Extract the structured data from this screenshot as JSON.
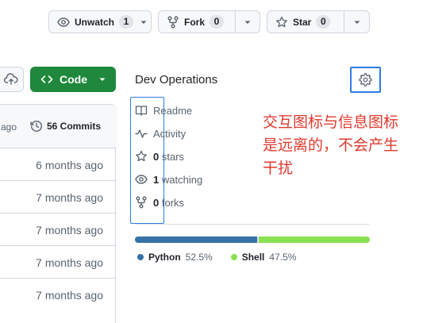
{
  "repo_actions": {
    "watch": {
      "label": "Unwatch",
      "count": "1",
      "icon": "eye-icon"
    },
    "fork": {
      "label": "Fork",
      "count": "0",
      "icon": "repo-forked-icon"
    },
    "star": {
      "label": "Star",
      "count": "0",
      "icon": "star-icon"
    }
  },
  "code_button": {
    "label": "Code"
  },
  "commits": {
    "ago_fragment": "ago",
    "count_label": "56 Commits",
    "rows": [
      "6 months ago",
      "7 months ago",
      "7 months ago",
      "7 months ago",
      "7 months ago"
    ]
  },
  "about": {
    "description": "Dev Operations",
    "links": [
      {
        "icon": "book-icon",
        "bold": "",
        "text": "Readme"
      },
      {
        "icon": "pulse-icon",
        "bold": "",
        "text": "Activity"
      },
      {
        "icon": "star-icon",
        "bold": "0",
        "text": "stars"
      },
      {
        "icon": "eye-icon",
        "bold": "1",
        "text": "watching"
      },
      {
        "icon": "repo-forked-icon",
        "bold": "0",
        "text": "forks"
      }
    ]
  },
  "annotation": {
    "text": "交互图标与信息图标是远离的，不会产生干扰"
  },
  "languages": [
    {
      "name": "Python",
      "percent": "52.5%",
      "value": 52.5,
      "color": "#3572A5"
    },
    {
      "name": "Shell",
      "percent": "47.5%",
      "value": 47.5,
      "color": "#89e051"
    }
  ],
  "colors": {
    "accent_green": "#1f883d",
    "highlight_blue": "#2f7de1",
    "annotation_red": "#e03a2e"
  }
}
